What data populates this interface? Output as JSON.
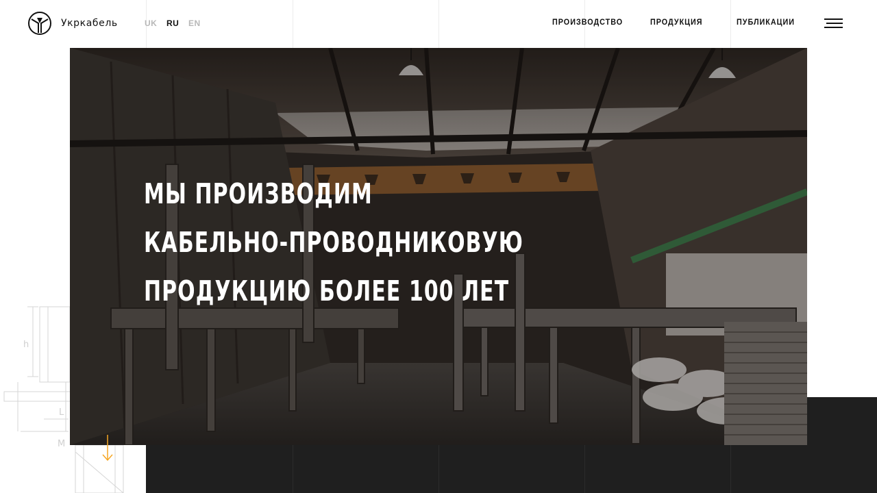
{
  "header": {
    "brand": "Укркабель",
    "languages": [
      {
        "code": "UK",
        "active": false
      },
      {
        "code": "RU",
        "active": true
      },
      {
        "code": "EN",
        "active": false
      }
    ],
    "nav": [
      "ПРОИЗВОДСТВО",
      "ПРОДУКЦИЯ",
      "ПУБЛИКАЦИИ"
    ],
    "menu_icon": "hamburger-menu-icon"
  },
  "hero": {
    "title_lines": [
      "МЫ ПРОИЗВОДИМ",
      "КАБЕЛЬНО-ПРОВОДНИКОВУЮ",
      "ПРОДУКЦИЮ БОЛЕЕ 100 ЛЕТ"
    ],
    "image": "factory-interior-photo"
  },
  "blueprint": {
    "labels": [
      "h",
      "L",
      "M"
    ]
  },
  "scroll": {
    "icon": "arrow-down-icon"
  },
  "colors": {
    "accent": "#f5a623",
    "dark_block": "#1f1f1f",
    "text": "#111111",
    "lang_inactive": "#b8b8b8"
  }
}
